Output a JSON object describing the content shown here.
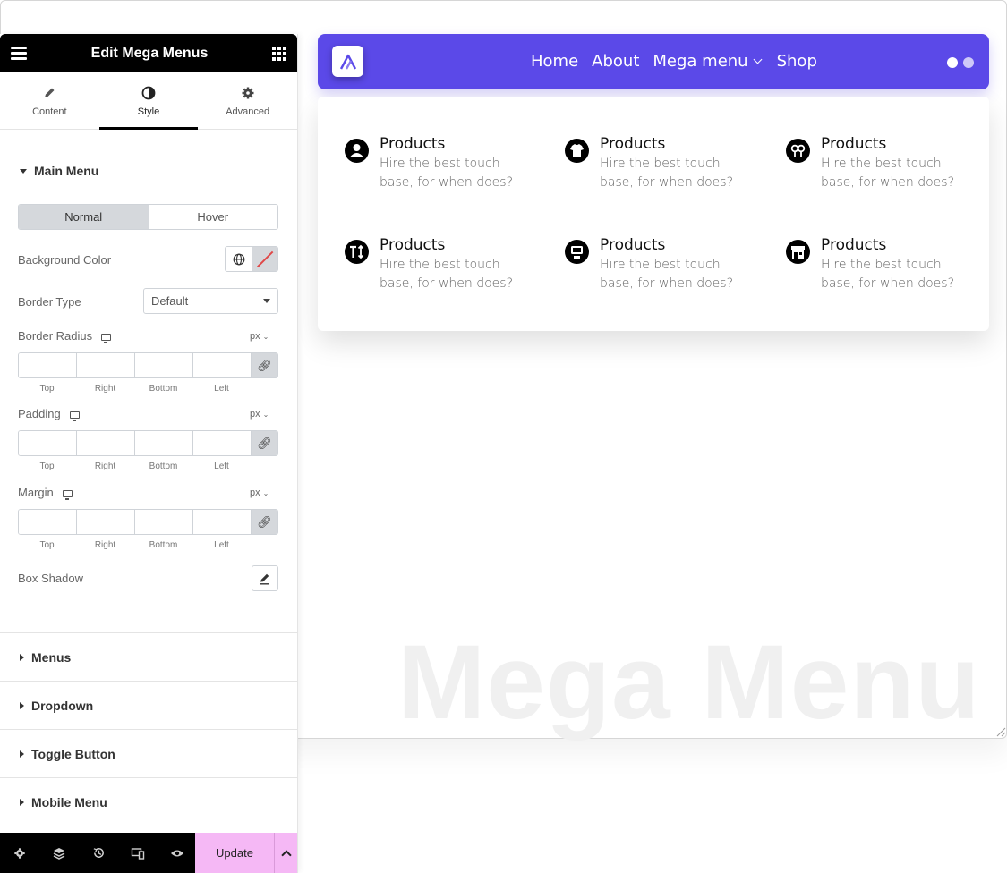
{
  "editor": {
    "title": "Edit Mega Menus",
    "tabs": [
      {
        "label": "Content",
        "icon": "pencil-icon"
      },
      {
        "label": "Style",
        "icon": "contrast-icon"
      },
      {
        "label": "Advanced",
        "icon": "gear-icon"
      }
    ],
    "active_tab": "Style",
    "main_menu": {
      "section_label": "Main Menu",
      "state_tabs": [
        "Normal",
        "Hover"
      ],
      "active_state": "Normal",
      "background_color_label": "Background Color",
      "border_type_label": "Border Type",
      "border_type_value": "Default",
      "border_radius_label": "Border Radius",
      "padding_label": "Padding",
      "margin_label": "Margin",
      "unit": "px",
      "dim_labels": [
        "Top",
        "Right",
        "Bottom",
        "Left"
      ],
      "box_shadow_label": "Box Shadow"
    },
    "accordions": [
      "Menus",
      "Dropdown",
      "Toggle Button",
      "Mobile Menu"
    ],
    "footer": {
      "icons": [
        "settings-icon",
        "layers-icon",
        "history-icon",
        "responsive-icon",
        "preview-eye-icon"
      ],
      "update_label": "Update"
    }
  },
  "navbar": {
    "links": [
      "Home",
      "About",
      "Mega menu",
      "Shop"
    ],
    "accent_color": "#5b49e8"
  },
  "mega_menu": {
    "items": [
      {
        "title": "Products",
        "desc": "Hire the best touch base, for when does?",
        "icon": "user-circle-icon"
      },
      {
        "title": "Products",
        "desc": "Hire the best touch base, for when does?",
        "icon": "tshirt-icon"
      },
      {
        "title": "Products",
        "desc": "Hire the best touch base, for when does?",
        "icon": "gender-icon"
      },
      {
        "title": "Products",
        "desc": "Hire the best touch base, for when does?",
        "icon": "text-height-icon"
      },
      {
        "title": "Products",
        "desc": "Hire the best touch base, for when does?",
        "icon": "computer-icon"
      },
      {
        "title": "Products",
        "desc": "Hire the best touch base, for when does?",
        "icon": "store-icon"
      }
    ]
  },
  "watermark": "Mega Menu"
}
